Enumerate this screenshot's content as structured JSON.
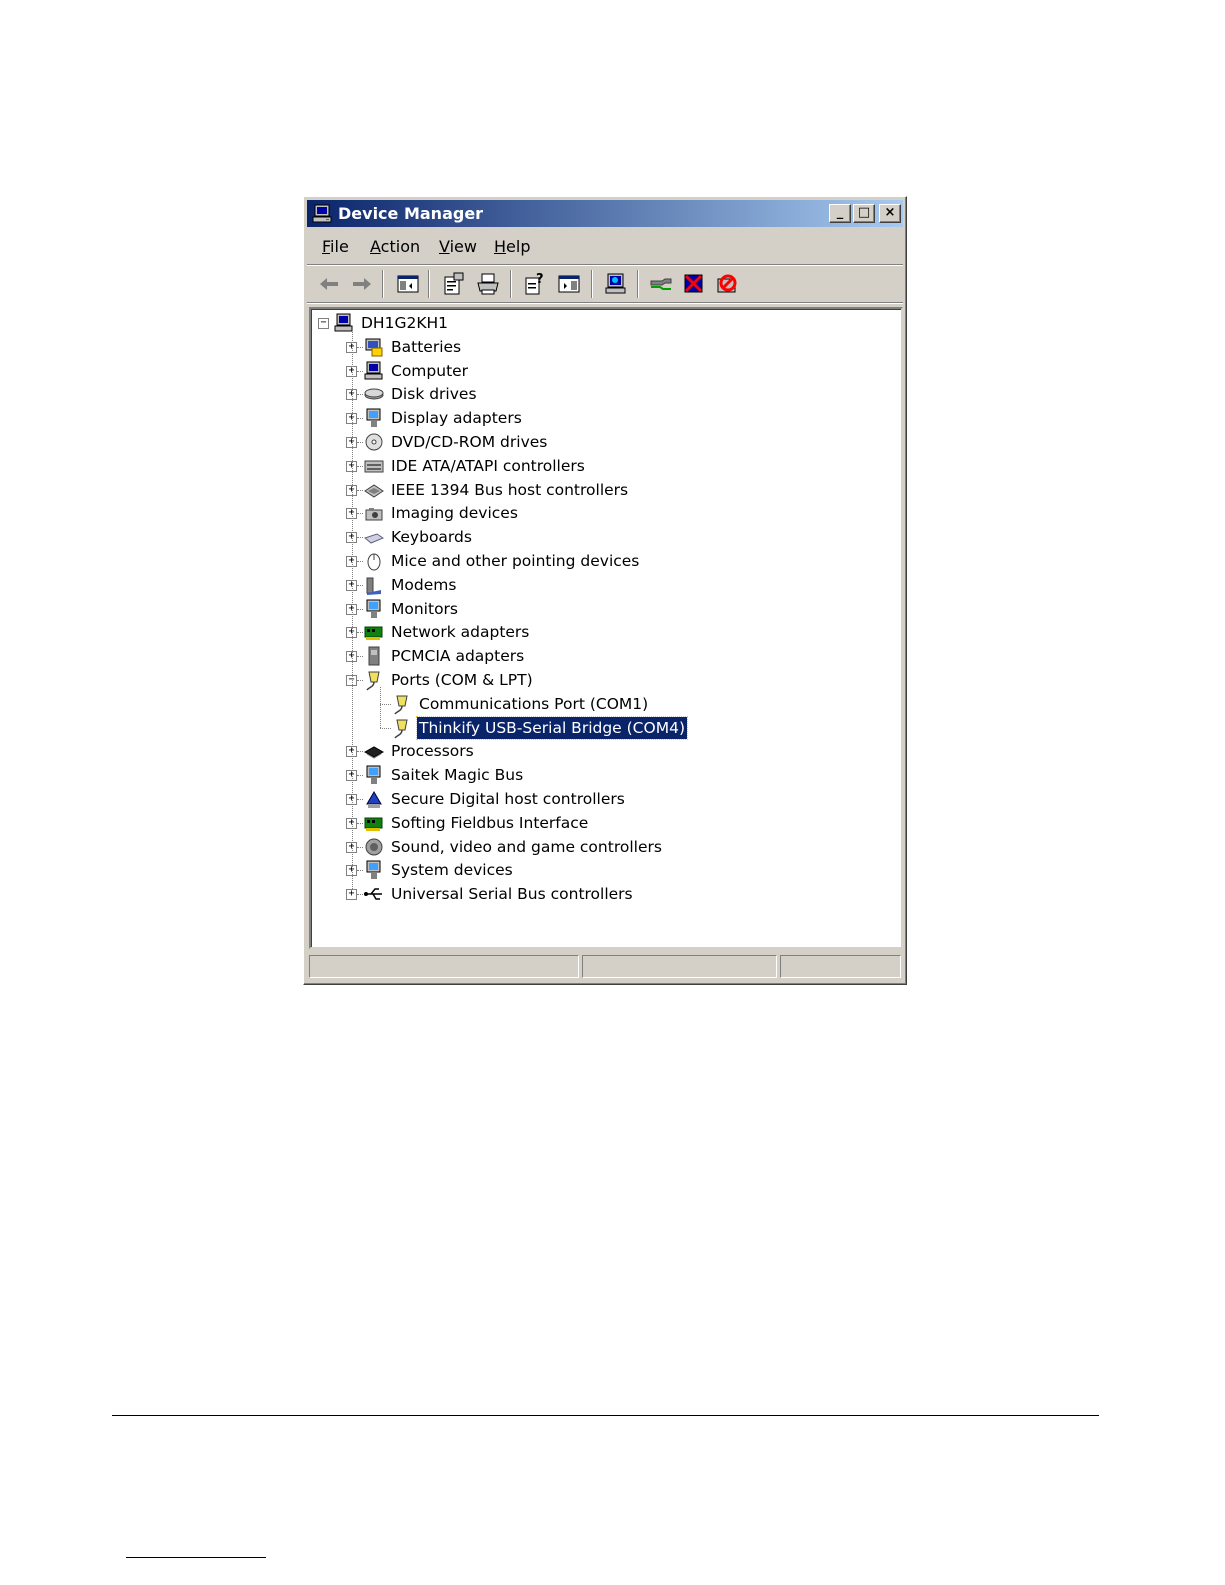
{
  "window": {
    "title": "Device Manager",
    "controls": {
      "minimize": "_",
      "maximize": "□",
      "close": "×"
    }
  },
  "menu": [
    {
      "label": "File",
      "mnemonic": "F"
    },
    {
      "label": "Action",
      "mnemonic": "A"
    },
    {
      "label": "View",
      "mnemonic": "V"
    },
    {
      "label": "Help",
      "mnemonic": "H"
    }
  ],
  "toolbar": [
    "back-icon",
    "forward-icon",
    "show-hide-console-tree-icon",
    "properties-icon",
    "print-icon",
    "help-icon",
    "show-hide-action-pane-icon",
    "scan-hardware-icon",
    "update-driver-icon",
    "uninstall-icon",
    "disable-icon"
  ],
  "tree": {
    "root": "DH1G2KH1",
    "categories": [
      {
        "label": "Batteries",
        "icon": "battery-icon"
      },
      {
        "label": "Computer",
        "icon": "computer-icon"
      },
      {
        "label": "Disk drives",
        "icon": "disk-drive-icon"
      },
      {
        "label": "Display adapters",
        "icon": "display-adapter-icon"
      },
      {
        "label": "DVD/CD-ROM drives",
        "icon": "cdrom-icon"
      },
      {
        "label": "IDE ATA/ATAPI controllers",
        "icon": "ide-controller-icon"
      },
      {
        "label": "IEEE 1394 Bus host controllers",
        "icon": "firewire-icon"
      },
      {
        "label": "Imaging devices",
        "icon": "camera-icon"
      },
      {
        "label": "Keyboards",
        "icon": "keyboard-icon"
      },
      {
        "label": "Mice and other pointing devices",
        "icon": "mouse-icon"
      },
      {
        "label": "Modems",
        "icon": "modem-icon"
      },
      {
        "label": "Monitors",
        "icon": "monitor-icon"
      },
      {
        "label": "Network adapters",
        "icon": "network-card-icon"
      },
      {
        "label": "PCMCIA adapters",
        "icon": "pcmcia-icon"
      },
      {
        "label": "Ports (COM & LPT)",
        "icon": "port-icon",
        "expanded": true,
        "children": [
          {
            "label": "Communications Port (COM1)",
            "icon": "port-icon"
          },
          {
            "label": "Thinkify USB-Serial Bridge (COM4)",
            "icon": "port-icon",
            "selected": true
          }
        ]
      },
      {
        "label": "Processors",
        "icon": "processor-icon"
      },
      {
        "label": "Saitek Magic Bus",
        "icon": "system-device-icon"
      },
      {
        "label": "Secure Digital host controllers",
        "icon": "sd-controller-icon"
      },
      {
        "label": "Softing Fieldbus Interface",
        "icon": "network-card-icon"
      },
      {
        "label": "Sound, video and game controllers",
        "icon": "speaker-icon"
      },
      {
        "label": "System devices",
        "icon": "system-device-icon"
      },
      {
        "label": "Universal Serial Bus controllers",
        "icon": "usb-icon"
      }
    ]
  },
  "statusbar": [
    "",
    "",
    ""
  ],
  "colors": {
    "titlebar_start": "#0a246a",
    "titlebar_end": "#a6caf0",
    "face": "#d4d0c8",
    "selection": "#0a246a"
  }
}
